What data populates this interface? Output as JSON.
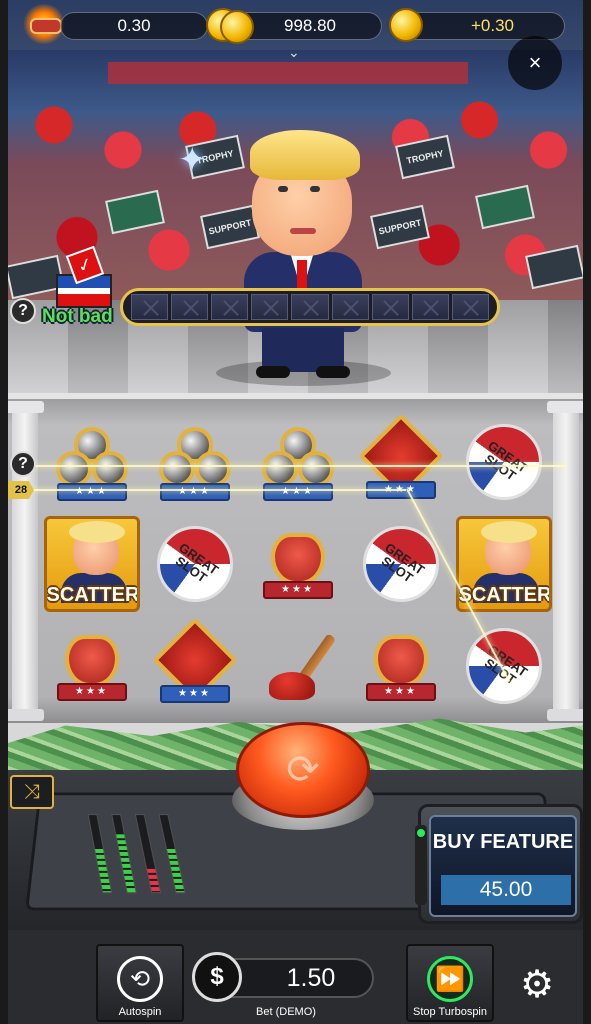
{
  "top_bar": {
    "left_value": "0.30",
    "balance": "998.80",
    "win_delta": "+0.30",
    "expand_icon": "chevron-down-icon",
    "close_label": "×"
  },
  "scene": {
    "sign_texts": [
      "TROPHY",
      "SUPPORT",
      "TROPHY",
      "SUPPORT"
    ],
    "meter_cells": 9,
    "meter_status": "Not bad",
    "help_label": "?"
  },
  "reels": {
    "help_label": "?",
    "line_number": "28",
    "grid": [
      [
        "club",
        "club",
        "club",
        "diamond",
        "great-slot"
      ],
      [
        "scatter",
        "great-slot",
        "heart",
        "great-slot",
        "scatter"
      ],
      [
        "heart",
        "diamond",
        "plunger",
        "heart",
        "great-slot"
      ]
    ],
    "great_slot_text": "GREAT SLOT",
    "scatter_text": "SCATTER",
    "ribbon_stars": "★★★"
  },
  "machine": {
    "mix_icon": "shuffle-icon",
    "spin_icon": "refresh-icon",
    "buy_feature_title": "BUY FEATURE",
    "buy_feature_price": "45.00",
    "slider_levels": [
      0.55,
      0.75,
      0.3,
      0.55
    ]
  },
  "bottom_bar": {
    "autospin_label": "Autospin",
    "bet_value": "1.50",
    "bet_label": "Bet (DEMO)",
    "turbo_label": "Stop Turbospin",
    "settings_icon": "gear-icon"
  },
  "colors": {
    "accent_gold": "#e3b23c",
    "meter_border": "#e8c54a",
    "win_text": "#ffe066",
    "turbo_green": "#2ee860",
    "not_bad_green": "#5fe05a"
  }
}
